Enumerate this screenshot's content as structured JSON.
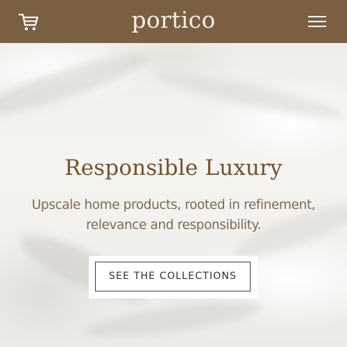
{
  "header": {
    "brand": "portico",
    "cart_icon": "cart-icon",
    "menu_icon": "hamburger-menu-icon",
    "background_color": "#7a5f43"
  },
  "hero": {
    "headline": "Responsible Luxury",
    "tagline": "Upscale home products, rooted in refinement, relevance and responsibility.",
    "cta_label": "SEE THE COLLECTIONS"
  },
  "colors": {
    "headline": "#6f5132",
    "tagline": "#7b6a56",
    "cta_border": "#3a3a3a"
  }
}
